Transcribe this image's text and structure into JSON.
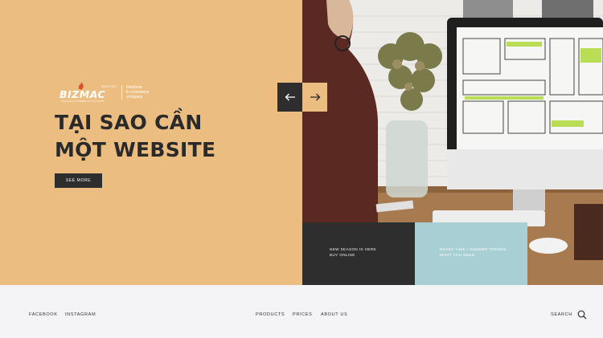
{
  "logo": {
    "wordmark": "BIZMAC",
    "since": "SINCE 2007",
    "tagline_under": "WEB AND E-COMMERCE SOLUTIONS",
    "slogan_lines": [
      "Rainbow",
      "E-commerce",
      "company"
    ]
  },
  "hero": {
    "title_lines": [
      "TẠI SAO CẦN",
      "MỘT WEBSITE"
    ],
    "cta_label": "SEE MORE",
    "prev_icon": "arrow-left-icon",
    "next_icon": "arrow-right-icon"
  },
  "promos": [
    {
      "lines": [
        "NEW SEASON IS HERE",
        "BUY ONLINE"
      ]
    },
    {
      "lines": [
        "READY TIME / SUMMER TRENDS",
        "WHAT YOU NEED"
      ]
    }
  ],
  "footer": {
    "social": [
      "FACEBOOK",
      "INSTAGRAM"
    ],
    "nav": [
      "PRODUCTS",
      "PRICES",
      "ABOUT US"
    ],
    "search_label": "SEARCH",
    "search_icon": "search-icon"
  },
  "colors": {
    "hero_bg": "#ebbd80",
    "dark": "#2e2e2e",
    "teal": "#a8cfd3",
    "footer_bg": "#f4f4f6"
  }
}
